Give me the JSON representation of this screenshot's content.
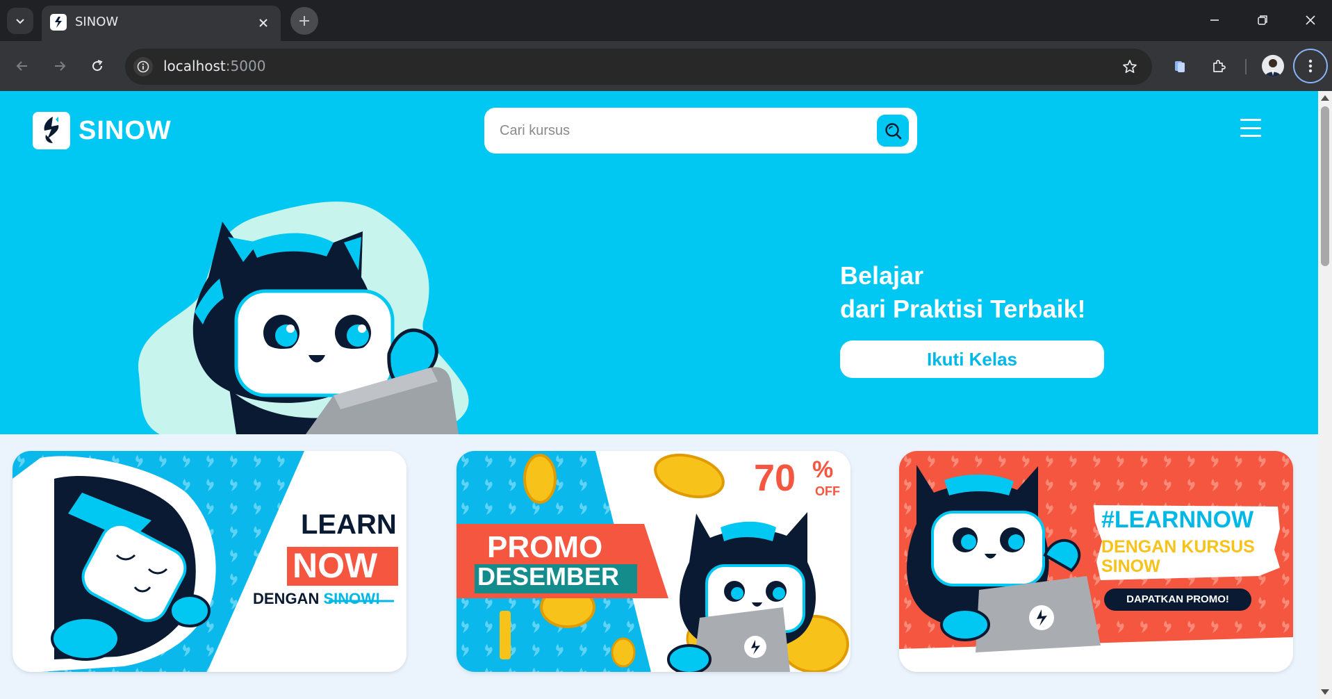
{
  "browser": {
    "tab_title": "SINOW",
    "url_host": "localhost",
    "url_port": ":5000"
  },
  "site": {
    "brand": "SINOW",
    "search_placeholder": "Cari kursus",
    "hero": {
      "line1": "Belajar",
      "line2": "dari Praktisi Terbaik!",
      "cta": "Ikuti Kelas"
    },
    "banners": [
      {
        "line1": "LEARN",
        "line2": "NOW",
        "line3_prefix": "DENGAN",
        "line3_link": "SINOW!"
      },
      {
        "discount": "70",
        "percent": "%",
        "off": "OFF",
        "line1": "PROMO",
        "line2": "DESEMBER"
      },
      {
        "hashtag": "#LEARNNOW",
        "line1": "DENGAN KURSUS",
        "line2": "SINOW",
        "cta": "DAPATKAN PROMO!"
      }
    ]
  },
  "colors": {
    "brand_cyan": "#00c8f2",
    "navy": "#0b1a33",
    "promo_red": "#f4563f",
    "page_bg": "#ebf3fc"
  }
}
